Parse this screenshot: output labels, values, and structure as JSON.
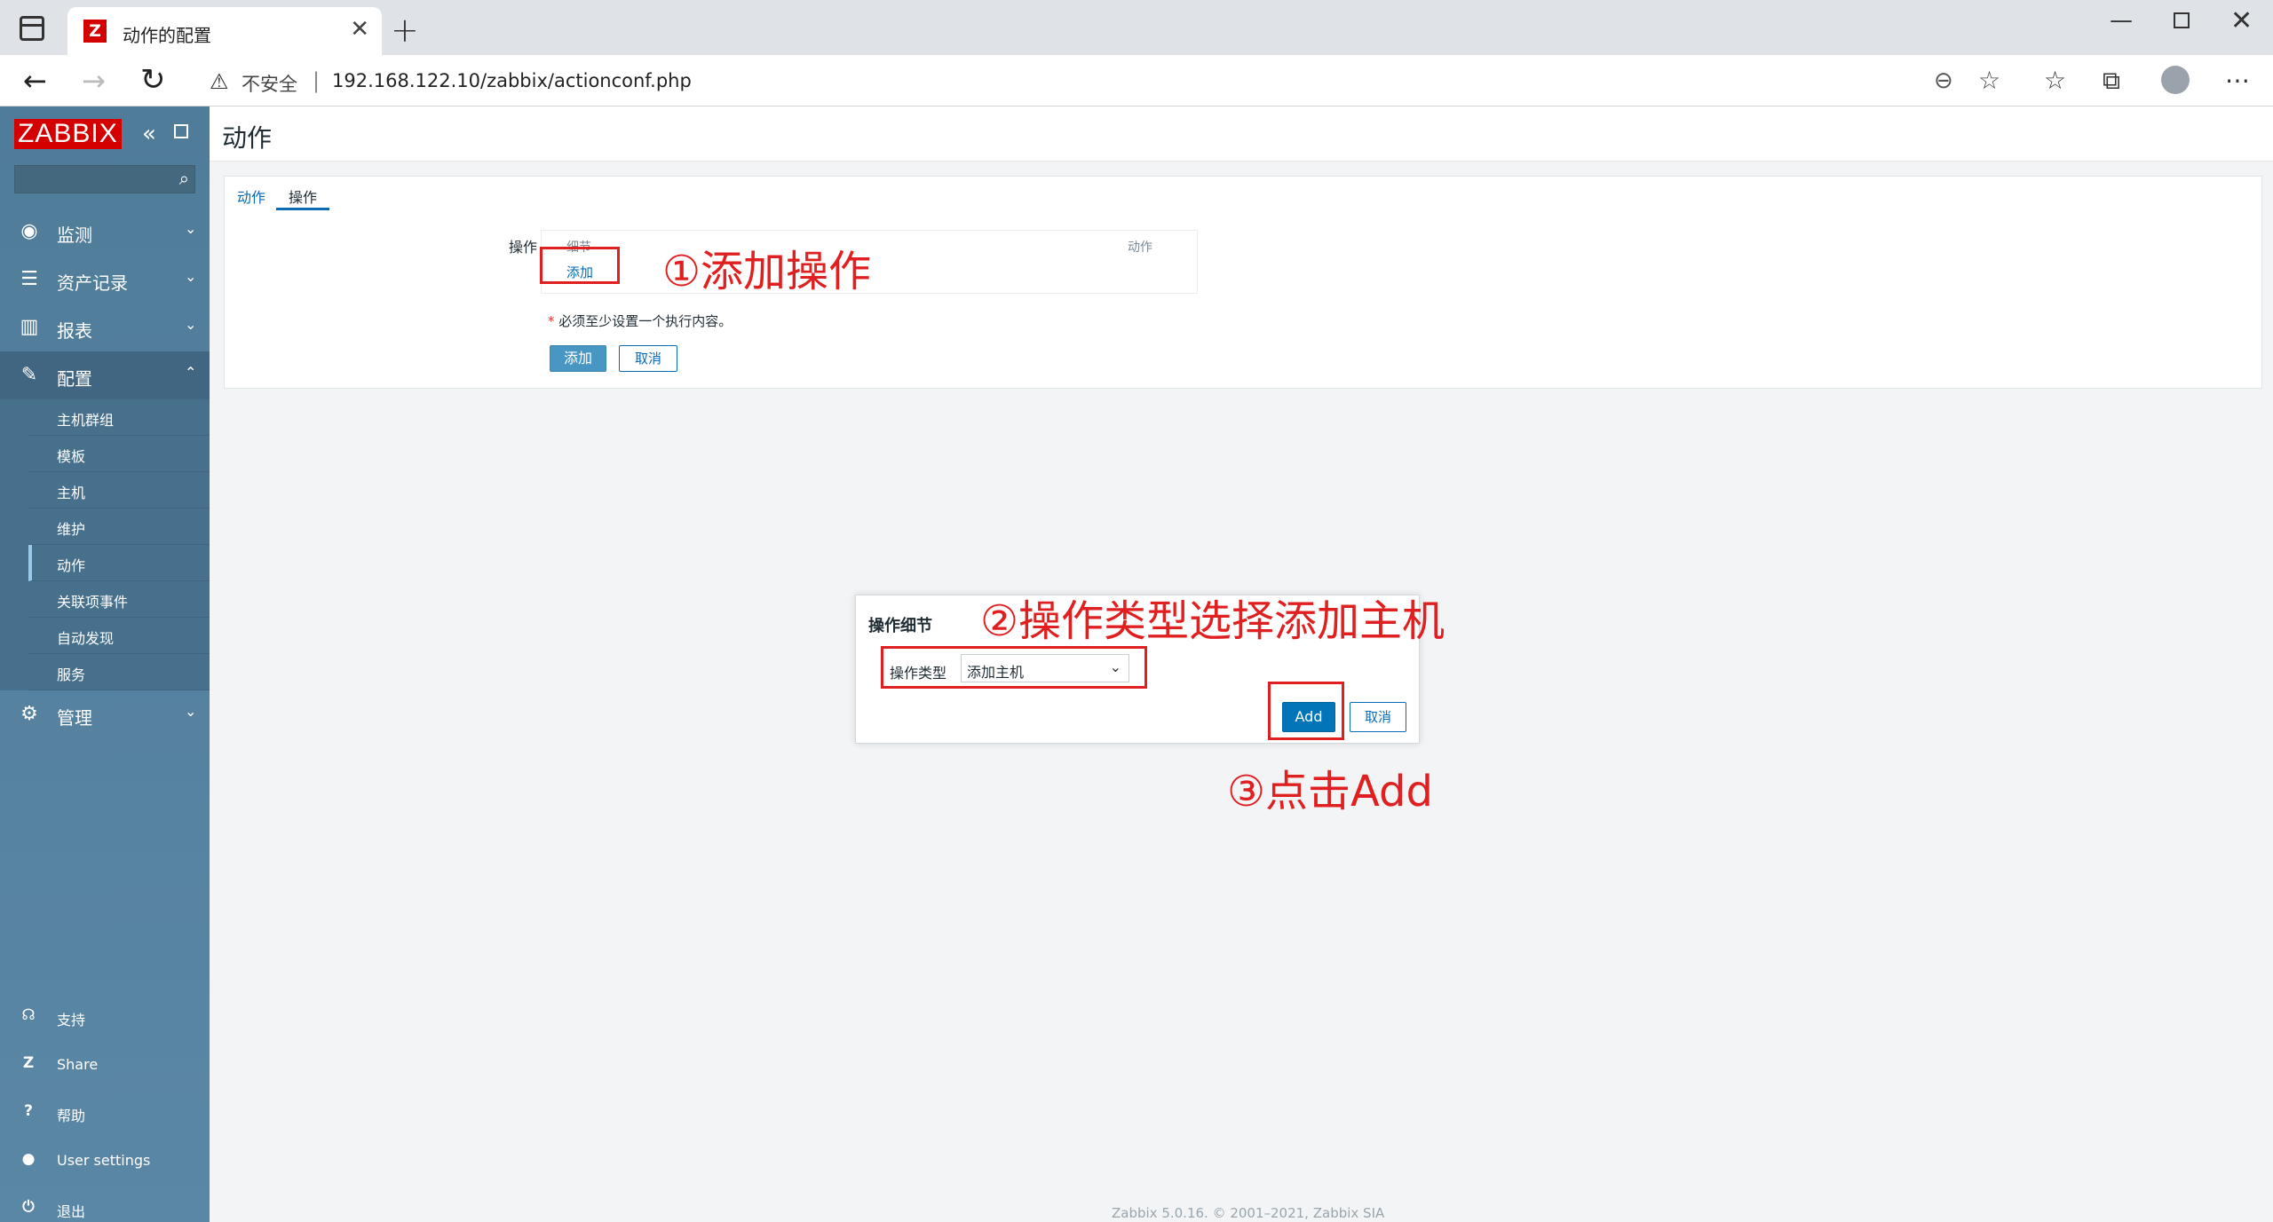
{
  "browser": {
    "tab_title": "动作的配置",
    "tab_icon_letter": "Z",
    "insecure_label": "不安全",
    "separator": "|",
    "url": "192.168.122.10/zabbix/actionconf.php"
  },
  "sidebar": {
    "logo": "ZABBIX",
    "menu": [
      {
        "label": "监测",
        "icon": "eye-icon"
      },
      {
        "label": "资产记录",
        "icon": "list-icon"
      },
      {
        "label": "报表",
        "icon": "chart-icon"
      },
      {
        "label": "配置",
        "icon": "wrench-icon"
      },
      {
        "label": "管理",
        "icon": "gear-icon"
      }
    ],
    "submenu": [
      "主机群组",
      "模板",
      "主机",
      "维护",
      "动作",
      "关联项事件",
      "自动发现",
      "服务"
    ],
    "bottom": [
      {
        "label": "支持",
        "icon": "headset-icon"
      },
      {
        "label": "Share",
        "icon": "zabbix-share-icon"
      },
      {
        "label": "帮助",
        "icon": "help-icon"
      },
      {
        "label": "User settings",
        "icon": "user-icon"
      },
      {
        "label": "退出",
        "icon": "power-icon"
      }
    ]
  },
  "page": {
    "title": "动作",
    "tabs": [
      "动作",
      "操作"
    ],
    "ops_label": "操作",
    "ops_col_details": "细节",
    "ops_col_action": "动作",
    "ops_add_link": "添加",
    "required_note": "必须至少设置一个执行内容。",
    "add_button": "添加",
    "cancel_button": "取消"
  },
  "dialog": {
    "title": "操作细节",
    "op_type_label": "操作类型",
    "op_type_value": "添加主机",
    "add_button": "Add",
    "cancel_button": "取消"
  },
  "footer": "Zabbix 5.0.16. © 2001–2021, Zabbix SIA",
  "annotations": {
    "step1": "①添加操作",
    "step2": "②操作类型选择添加主机",
    "step3": "③点击Add"
  },
  "colors": {
    "sidebar": "#5b87a6",
    "logo_bg": "#d40000",
    "primary": "#0275b8",
    "annotation": "#e02020"
  }
}
